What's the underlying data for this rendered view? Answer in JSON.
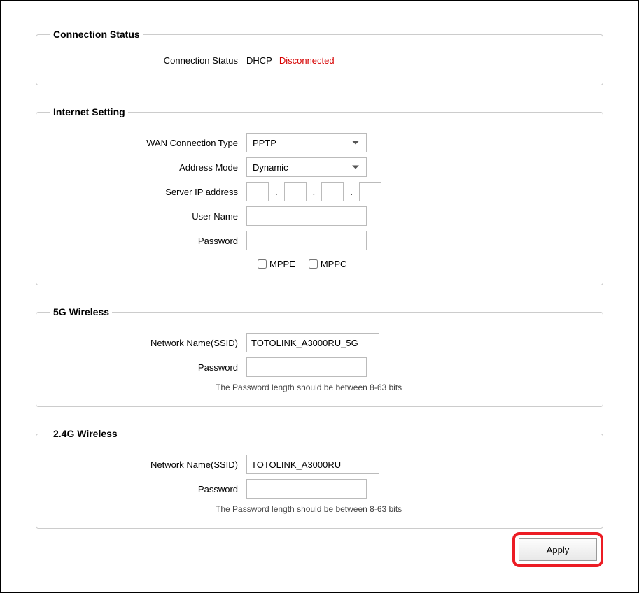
{
  "connection_status": {
    "legend": "Connection Status",
    "row_label": "Connection Status",
    "type": "DHCP",
    "state": "Disconnected"
  },
  "internet_setting": {
    "legend": "Internet Setting",
    "wan_label": "WAN Connection Type",
    "wan_value": "PPTP",
    "address_mode_label": "Address Mode",
    "address_mode_value": "Dynamic",
    "server_ip_label": "Server IP address",
    "user_name_label": "User Name",
    "user_name_value": "",
    "password_label": "Password",
    "password_value": "",
    "mppe_label": "MPPE",
    "mppc_label": "MPPC"
  },
  "wireless_5g": {
    "legend": "5G Wireless",
    "ssid_label": "Network Name(SSID)",
    "ssid_value": "TOTOLINK_A3000RU_5G",
    "password_label": "Password",
    "password_value": "",
    "hint": "The Password length should be between 8-63 bits"
  },
  "wireless_24g": {
    "legend": "2.4G Wireless",
    "ssid_label": "Network Name(SSID)",
    "ssid_value": "TOTOLINK_A3000RU",
    "password_label": "Password",
    "password_value": "",
    "hint": "The Password length should be between 8-63 bits"
  },
  "apply_label": "Apply"
}
